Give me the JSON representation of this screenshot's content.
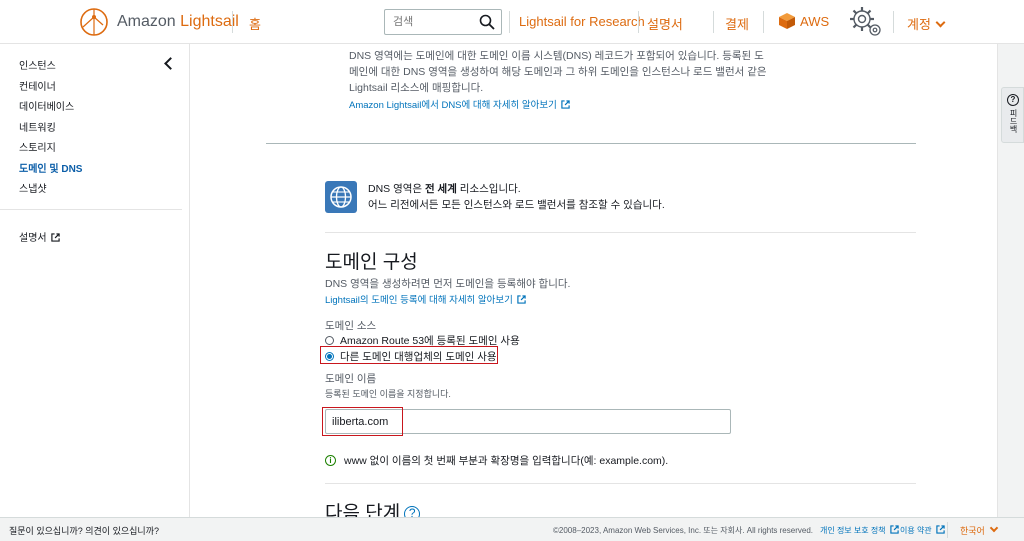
{
  "colors": {
    "brand": "#dd6b10",
    "link": "#0073bb",
    "highlight": "#c8161d",
    "success": "#1d8102"
  },
  "header": {
    "logo_prefix": "Amazon",
    "logo_brand": "Lightsail",
    "home": "홈",
    "search_placeholder": "검색",
    "research": "Lightsail for Research",
    "docs": "설명서",
    "billing": "결제",
    "aws": "AWS",
    "account": "계정"
  },
  "sidebar": {
    "items": [
      {
        "label": "인스턴스",
        "active": false
      },
      {
        "label": "컨테이너",
        "active": false
      },
      {
        "label": "데이터베이스",
        "active": false
      },
      {
        "label": "네트워킹",
        "active": false
      },
      {
        "label": "스토리지",
        "active": false
      },
      {
        "label": "도메인 및 DNS",
        "active": true
      },
      {
        "label": "스냅샷",
        "active": false
      }
    ],
    "docs": "설명서"
  },
  "intro": {
    "line1": "DNS 영역에는 도메인에 대한 도메인 이름 시스템(DNS) 레코드가 포함되어 있습니다. 등록된 도",
    "line2": "메인에 대한 DNS 영역을 생성하여 해당 도메인과 그 하위 도메인을 인스턴스나 로드 밸런서 같은",
    "line3": "Lightsail 리소스에 매핑합니다.",
    "link": "Amazon Lightsail에서 DNS에 대해 자세히 알아보기"
  },
  "global_notice": {
    "prefix": "DNS 영역은 ",
    "bold": "전 세계",
    "suffix": " 리소스입니다.",
    "line2": "어느 리전에서든 모든 인스턴스와 로드 밸런서를 참조할 수 있습니다."
  },
  "domain_config": {
    "title": "도메인 구성",
    "desc": "DNS 영역을 생성하려면 먼저 도메인을 등록해야 합니다.",
    "link": "Lightsail의 도메인 등록에 대해 자세히 알아보기",
    "source_label": "도메인 소스",
    "option1": "Amazon Route 53에 등록된 도메인 사용",
    "option2": "다른 도메인 대행업체의 도메인 사용",
    "selected": "option2",
    "name_label": "도메인 이름",
    "name_desc": "등록된 도메인 이름을 지정합니다.",
    "name_value": "iliberta.com",
    "hint": "www 없이 이름의 첫 번째 부분과 확장명을 입력합니다(예: example.com)."
  },
  "next_steps": {
    "title": "다음 단계",
    "help": "?"
  },
  "feedback_tab": {
    "icon": "?",
    "label": "피드백"
  },
  "footer": {
    "question": "질문이 있으십니까? 의견이 있으십니까?",
    "copyright": "©2008–2023, Amazon Web Services, Inc. 또는 자회사. All rights reserved.",
    "privacy": "개인 정보 보호 정책",
    "terms": "이용 약관",
    "language": "한국어"
  }
}
